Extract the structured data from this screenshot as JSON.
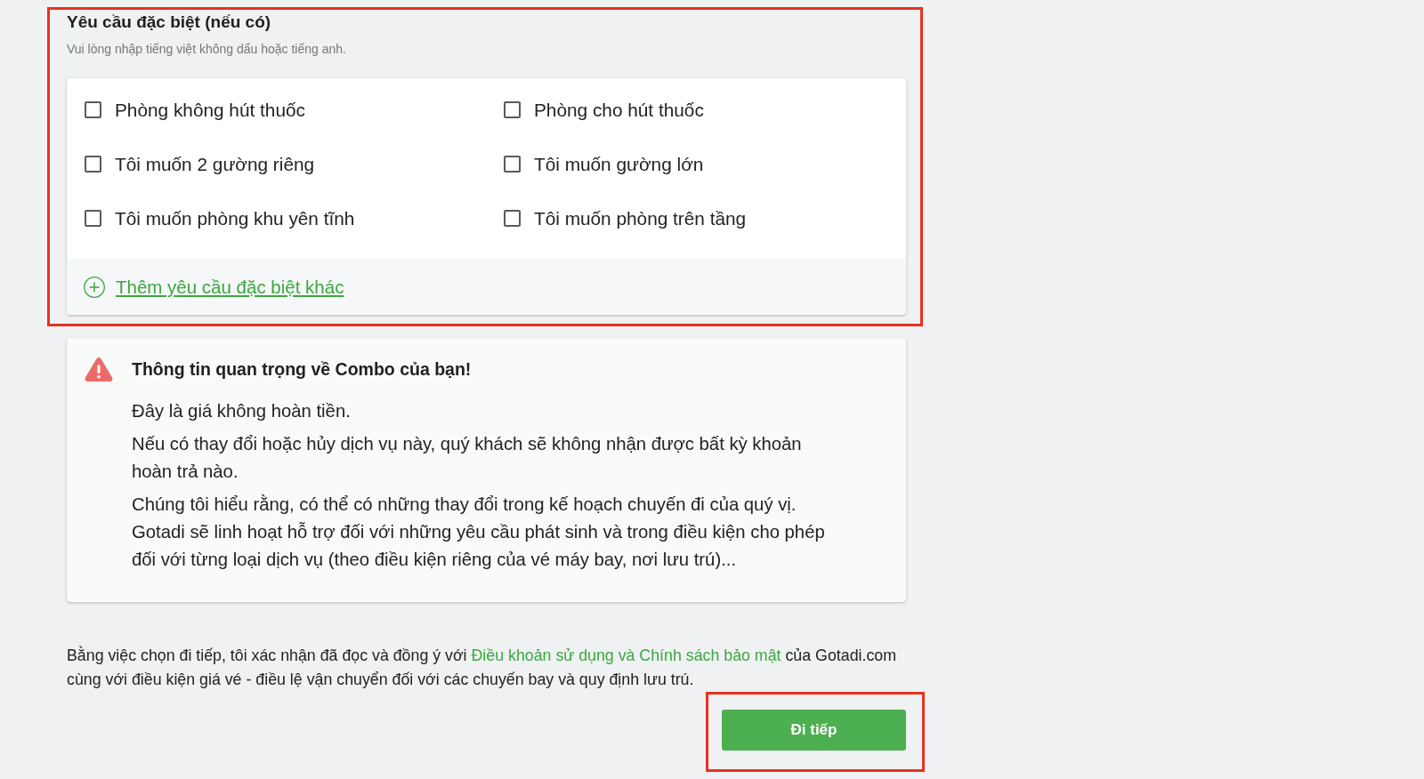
{
  "special_requests": {
    "highlighted": true,
    "title": "Yêu cầu đặc biệt (nếu có)",
    "subtitle": "Vui lòng nhập tiếng việt không dấu hoặc tiếng anh.",
    "options": [
      {
        "label": "Phòng không hút thuốc",
        "checked": false
      },
      {
        "label": "Phòng cho hút thuốc",
        "checked": false
      },
      {
        "label": "Tôi muốn 2 gường riêng",
        "checked": false
      },
      {
        "label": "Tôi muốn gường lớn",
        "checked": false
      },
      {
        "label": "Tôi muốn phòng khu yên tĩnh",
        "checked": false
      },
      {
        "label": "Tôi muốn phòng trên tầng",
        "checked": false
      }
    ],
    "add_link": "Thêm yêu cầu đặc biệt khác"
  },
  "notice": {
    "title": "Thông tin quan trọng về Combo của bạn!",
    "paragraphs": [
      {
        "lines": [
          "Đây là giá không hoàn tiền."
        ]
      },
      {
        "lines": [
          "Nếu có thay đổi hoặc hủy dịch vụ này, quý khách sẽ không nhận được bất kỳ khoản",
          "hoàn trả nào."
        ]
      },
      {
        "lines": [
          "Chúng tôi hiểu rằng, có thể có những thay đổi trong kế hoạch chuyến đi của quý vị.",
          "Gotadi sẽ linh hoạt hỗ trợ đối với những yêu cầu phát sinh và trong điều kiện cho phép",
          "đối với từng loại dịch vụ (theo điều kiện riêng của vé máy bay, nơi lưu trú)..."
        ]
      }
    ]
  },
  "consent": {
    "text_before": "Bằng việc chọn đi tiếp, tôi xác nhận đã đọc và đồng ý với",
    "link": "Điều khoản sử dụng và Chính sách bảo mật",
    "text_after": "của Gotadi.com",
    "second_line": "cùng với điều kiện giá vé - điều lệ vận chuyển đối với các chuyến bay và quy định lưu trú."
  },
  "continue_button": {
    "label": "Đi tiếp",
    "highlighted": true
  }
}
